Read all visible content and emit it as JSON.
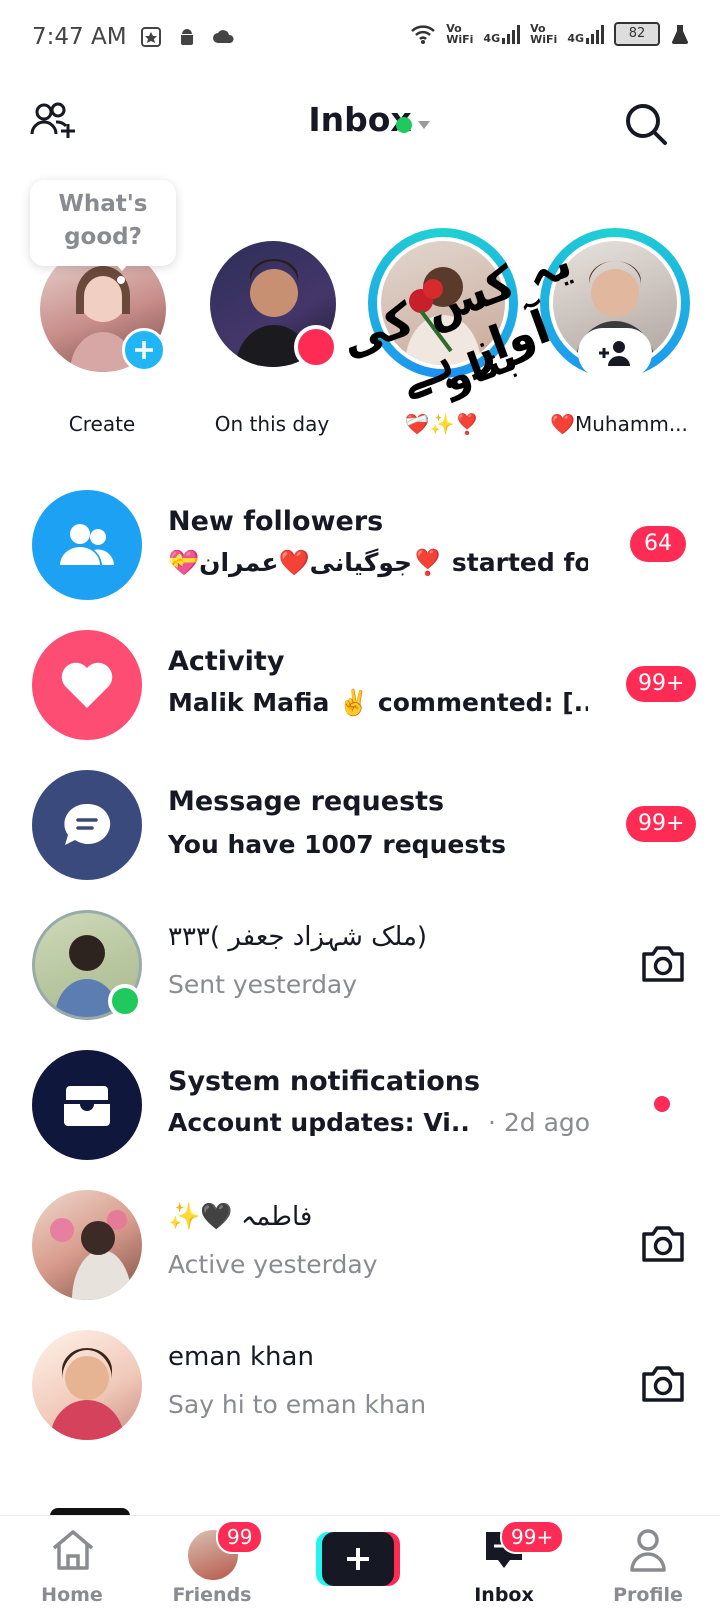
{
  "status_bar": {
    "time": "7:47 AM",
    "net1": "Vo\nWiFi",
    "net1_top": "Vo",
    "net1_bottom": "WiFi",
    "net1_tech": "4G",
    "net2_top": "Vo",
    "net2_bottom": "WiFi",
    "net2_tech": "4G",
    "battery": "82"
  },
  "header": {
    "title": "Inbox"
  },
  "stories": {
    "tooltip": "What's good?",
    "tooltip_line1": "What's",
    "tooltip_line2": "good?",
    "items": [
      {
        "label": "Create"
      },
      {
        "label": "On this day"
      },
      {
        "label": "❤️‍🩹✨❣️"
      },
      {
        "label": "❤️Muhamm..."
      }
    ],
    "overlay_line1": "یہ کس کی آواز ہے",
    "overlay_line2": "بتاو"
  },
  "rows": [
    {
      "title": "New followers",
      "subtitle": "💝جوگیانی❤️عمران❣️ started fo...",
      "badge": "64"
    },
    {
      "title": "Activity",
      "subtitle": "Malik Mafia ✌️ commented: [...",
      "badge": "99+"
    },
    {
      "title": "Message requests",
      "subtitle": "You have 1007 requests",
      "badge": "99+"
    },
    {
      "title": "(ملک شہزاد جعفر )٣٣٣",
      "subtitle": "Sent yesterday"
    },
    {
      "title": "System notifications",
      "subtitle": "Account updates: Vi...",
      "time": "· 2d ago"
    },
    {
      "title": "✨🖤 فاطمہ",
      "subtitle": "Active yesterday"
    },
    {
      "title": "eman khan",
      "subtitle": "Say hi to eman khan"
    }
  ],
  "nav": {
    "home": "Home",
    "friends": "Friends",
    "friends_badge": "99",
    "inbox": "Inbox",
    "inbox_badge": "99+",
    "profile": "Profile"
  },
  "colors": {
    "accent_red": "#fe2c55",
    "followers_blue": "#1da1f2",
    "activity_pink": "#fe4d73",
    "requests_navy": "#3a4a7c",
    "system_dark": "#10173d",
    "online_green": "#20c95d"
  }
}
